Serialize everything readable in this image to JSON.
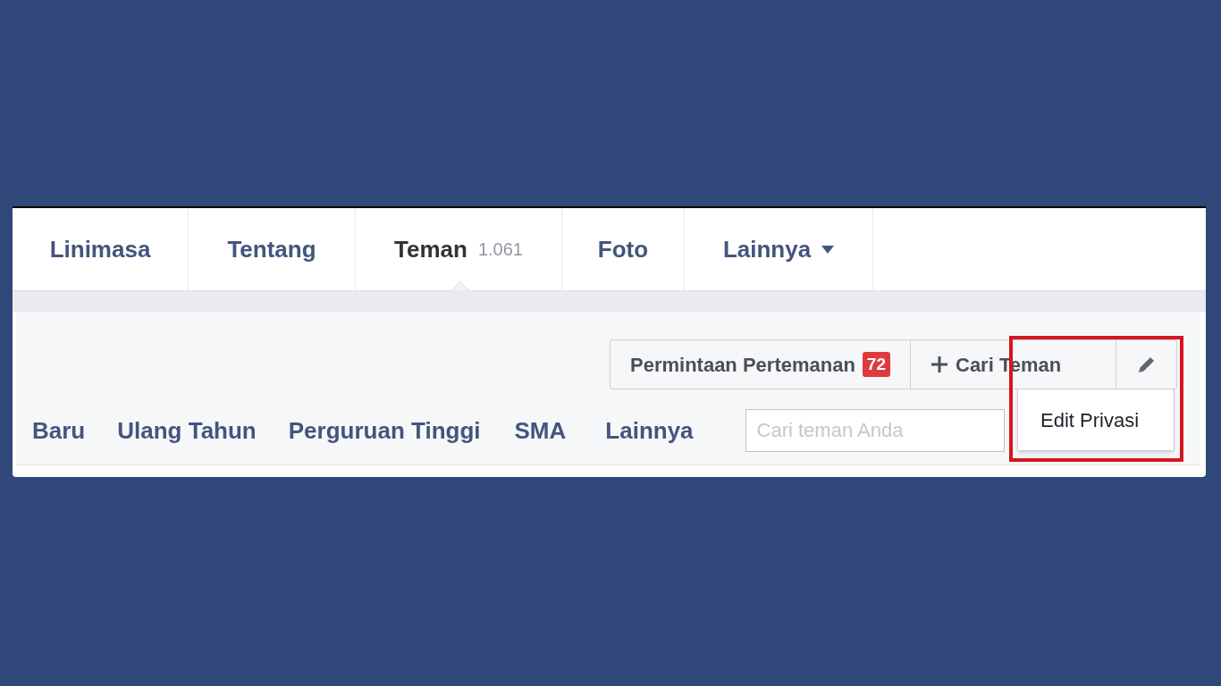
{
  "tabs": [
    {
      "label": "Linimasa",
      "kind": "link",
      "selected": false
    },
    {
      "label": "Tentang",
      "kind": "link",
      "selected": false
    },
    {
      "label": "Teman",
      "count": "1.061",
      "kind": "link",
      "selected": true
    },
    {
      "label": "Foto",
      "kind": "link",
      "selected": false
    },
    {
      "label": "Lainnya",
      "kind": "menu",
      "selected": false
    }
  ],
  "actions": {
    "requests": {
      "label": "Permintaan Pertemanan",
      "badge": "72"
    },
    "find": {
      "label": "Cari Teman"
    }
  },
  "filters": [
    "Baru",
    "Ulang Tahun",
    "Perguruan Tinggi",
    "SMA",
    "Lainnya"
  ],
  "search": {
    "placeholder": "Cari teman Anda"
  },
  "edit_menu": {
    "items": [
      "Edit Privasi"
    ]
  }
}
